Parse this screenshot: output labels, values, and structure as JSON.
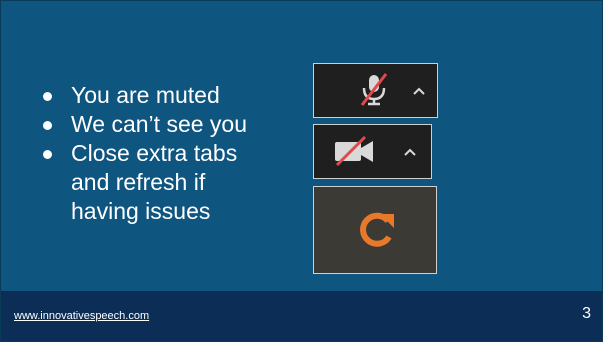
{
  "slide": {
    "bullets": [
      "You are muted",
      "We can’t see you",
      "Close extra tabs",
      "and refresh if",
      "having issues"
    ]
  },
  "controls": {
    "mic": {
      "icon": "muted-microphone-icon",
      "caret": "chevron-up-icon"
    },
    "camera": {
      "icon": "camera-off-icon",
      "caret": "chevron-up-icon"
    },
    "refresh": {
      "icon": "refresh-icon",
      "color": "#e8792b"
    }
  },
  "footer": {
    "url": "www.innovativespeech.com",
    "page_number": "3"
  },
  "colors": {
    "slide_bg": "#0e5580",
    "footer_bg": "#0c2e56",
    "slash_red": "#e04a4a",
    "icon_gray": "#d9d9d9"
  }
}
